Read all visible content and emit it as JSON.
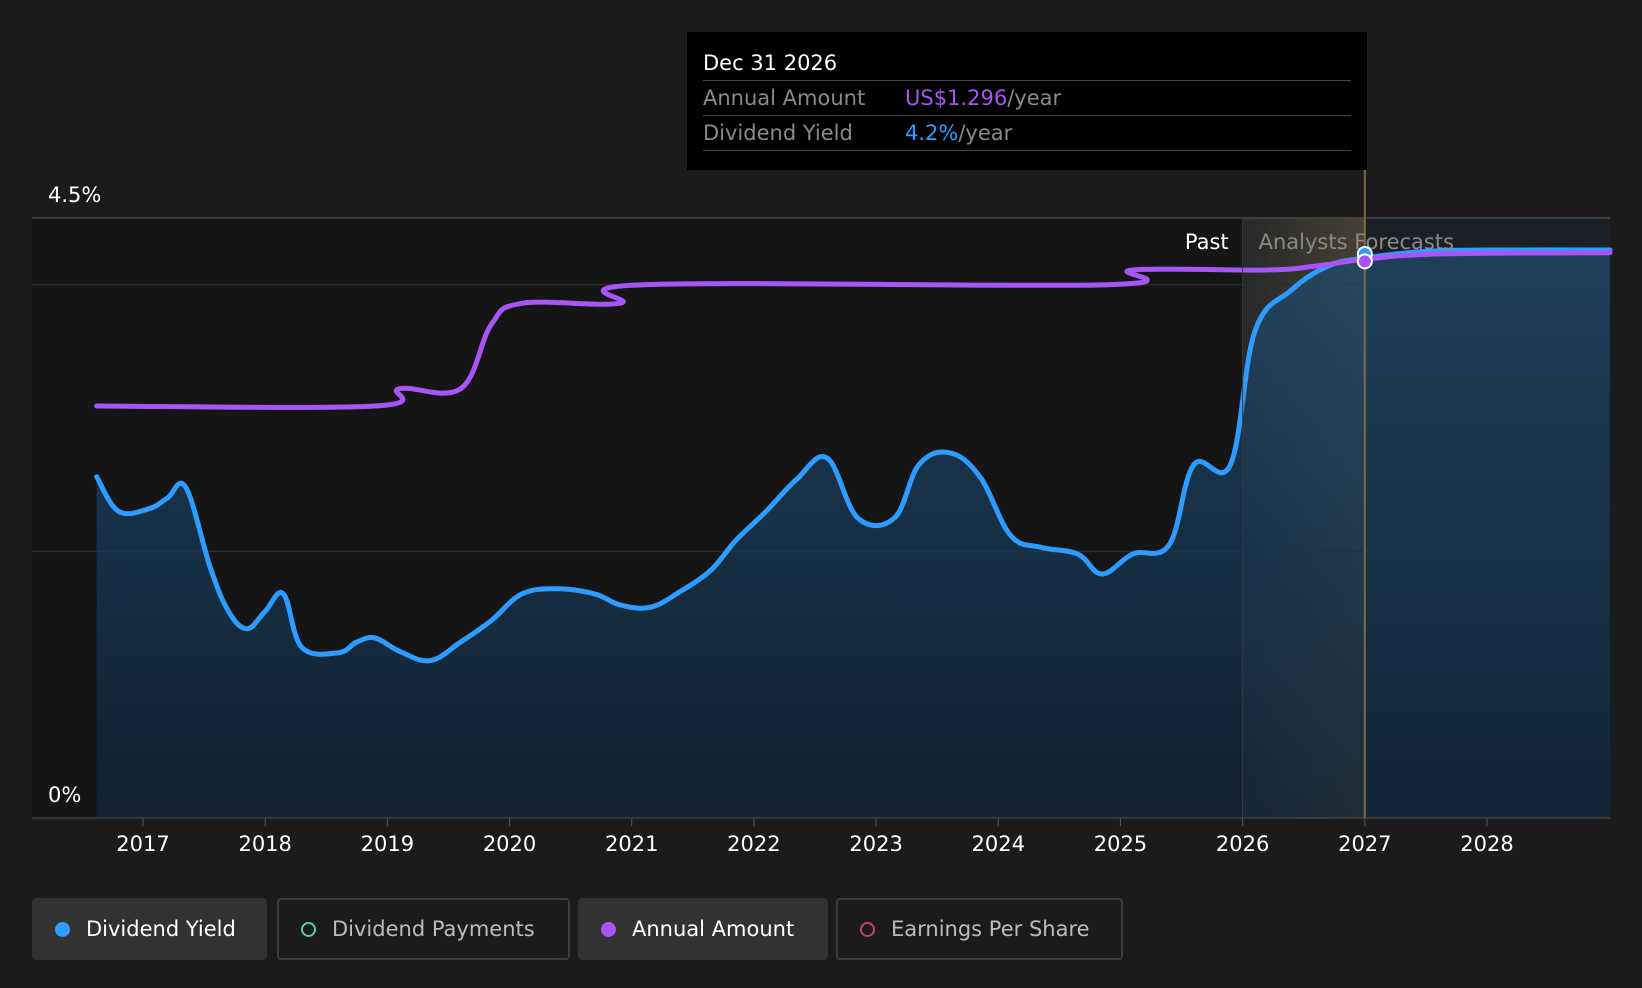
{
  "tooltip": {
    "date": "Dec 31 2026",
    "rows": [
      {
        "label": "Annual Amount",
        "value": "US$1.296",
        "unit": "/year"
      },
      {
        "label": "Dividend Yield",
        "value": "4.2%",
        "unit": "/year"
      }
    ]
  },
  "legend": [
    {
      "label": "Dividend Yield",
      "color": "#2d9cff",
      "active": true,
      "marker": "filled"
    },
    {
      "label": "Dividend Payments",
      "color": "#5ec8b4",
      "active": false,
      "marker": "hollow"
    },
    {
      "label": "Annual Amount",
      "color": "#a855f7",
      "active": true,
      "marker": "filled"
    },
    {
      "label": "Earnings Per Share",
      "color": "#c0407a",
      "active": false,
      "marker": "hollow"
    }
  ],
  "chart_data": {
    "type": "line",
    "y_tick_labels": [
      "4.5%",
      "0%"
    ],
    "ylim": [
      0,
      4.5
    ],
    "x_tick_labels": [
      "2017",
      "2018",
      "2019",
      "2020",
      "2021",
      "2022",
      "2023",
      "2024",
      "2025",
      "2026",
      "2027",
      "2028"
    ],
    "xlim": [
      2016.2,
      2029.0
    ],
    "regions": {
      "past_label": "Past",
      "forecast_label": "Analysts Forecasts",
      "past_end": 2026.0,
      "forecast_start": 2027.0
    },
    "highlight_x": 2027.0,
    "series": [
      {
        "name": "Dividend Yield",
        "color": "#2d9cff",
        "area": true,
        "points": [
          [
            2016.62,
            2.56
          ],
          [
            2016.8,
            2.3
          ],
          [
            2017.05,
            2.32
          ],
          [
            2017.2,
            2.4
          ],
          [
            2017.35,
            2.48
          ],
          [
            2017.55,
            1.88
          ],
          [
            2017.7,
            1.55
          ],
          [
            2017.85,
            1.42
          ],
          [
            2018.0,
            1.55
          ],
          [
            2018.15,
            1.68
          ],
          [
            2018.3,
            1.28
          ],
          [
            2018.6,
            1.24
          ],
          [
            2018.75,
            1.32
          ],
          [
            2018.9,
            1.35
          ],
          [
            2019.1,
            1.25
          ],
          [
            2019.35,
            1.18
          ],
          [
            2019.6,
            1.32
          ],
          [
            2019.85,
            1.48
          ],
          [
            2020.1,
            1.68
          ],
          [
            2020.4,
            1.72
          ],
          [
            2020.7,
            1.68
          ],
          [
            2020.9,
            1.6
          ],
          [
            2021.15,
            1.58
          ],
          [
            2021.4,
            1.7
          ],
          [
            2021.65,
            1.86
          ],
          [
            2021.85,
            2.08
          ],
          [
            2022.1,
            2.3
          ],
          [
            2022.35,
            2.54
          ],
          [
            2022.6,
            2.7
          ],
          [
            2022.85,
            2.25
          ],
          [
            2023.15,
            2.25
          ],
          [
            2023.35,
            2.65
          ],
          [
            2023.6,
            2.74
          ],
          [
            2023.85,
            2.56
          ],
          [
            2024.1,
            2.12
          ],
          [
            2024.35,
            2.03
          ],
          [
            2024.65,
            1.98
          ],
          [
            2024.85,
            1.83
          ],
          [
            2025.1,
            1.98
          ],
          [
            2025.4,
            2.05
          ],
          [
            2025.6,
            2.65
          ],
          [
            2025.9,
            2.65
          ],
          [
            2026.1,
            3.65
          ],
          [
            2026.4,
            3.96
          ],
          [
            2026.7,
            4.14
          ],
          [
            2027.0,
            4.2
          ],
          [
            2027.5,
            4.25
          ],
          [
            2028.0,
            4.26
          ],
          [
            2029.0,
            4.26
          ]
        ]
      },
      {
        "name": "Annual Amount",
        "color": "#a855f7",
        "area": false,
        "points": [
          [
            2016.62,
            3.09
          ],
          [
            2018.9,
            3.09
          ],
          [
            2019.1,
            3.22
          ],
          [
            2019.6,
            3.22
          ],
          [
            2019.85,
            3.7
          ],
          [
            2020.1,
            3.86
          ],
          [
            2020.9,
            3.86
          ],
          [
            2021.1,
            4.0
          ],
          [
            2024.9,
            4.0
          ],
          [
            2025.1,
            4.11
          ],
          [
            2026.2,
            4.11
          ],
          [
            2026.6,
            4.14
          ],
          [
            2027.0,
            4.19
          ],
          [
            2027.6,
            4.23
          ],
          [
            2029.0,
            4.24
          ]
        ]
      }
    ],
    "highlight_values": {
      "Dividend Yield": 4.2,
      "Annual Amount": 1.296
    }
  }
}
